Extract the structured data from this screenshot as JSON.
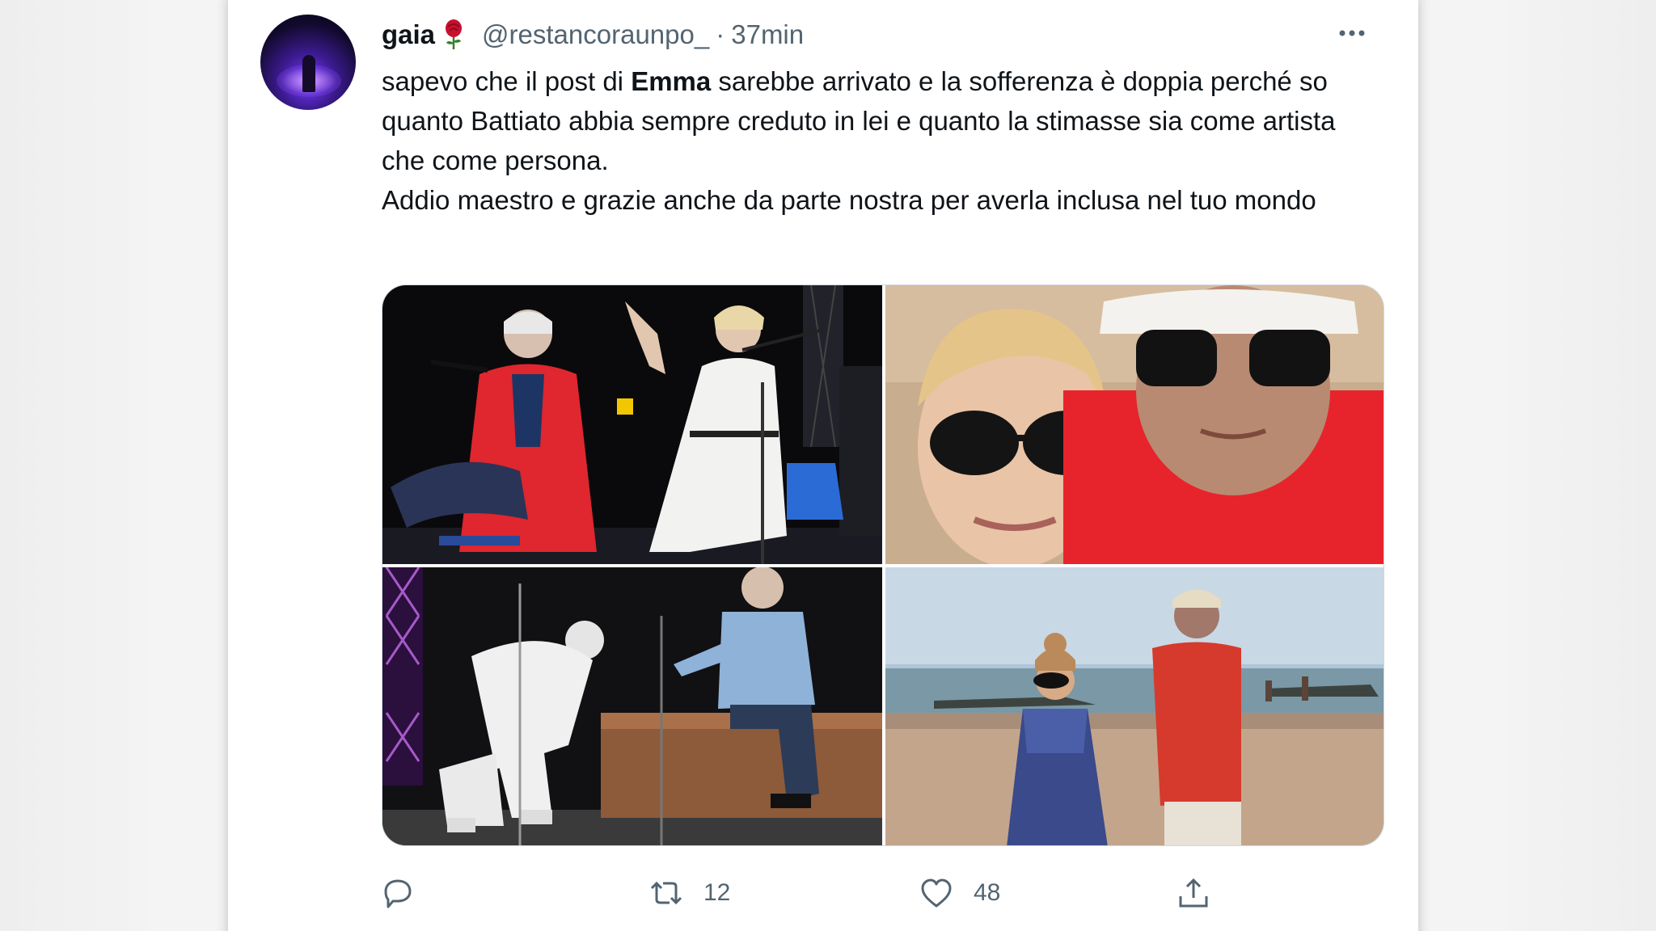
{
  "tweet": {
    "display_name": "gaia",
    "name_emoji": "rose-icon",
    "handle": "@restancoraunpo_",
    "separator": "·",
    "time": "37min",
    "text_line1_before": "sapevo che il post di ",
    "text_line1_bold": "Emma",
    "text_line1_after": " sarebbe arrivato e la sofferenza è doppia perché so quanto Battiato abbia sempre creduto in lei e quanto la stimasse sia come artista che come persona.",
    "text_line2": "Addio maestro e grazie anche da parte nostra per averla inclusa nel tuo mondo",
    "photos": [
      {
        "name": "concert-photo-red-jacket",
        "icon": "photo"
      },
      {
        "name": "selfie-beach-sunglasses",
        "icon": "photo"
      },
      {
        "name": "stage-handshake-photo",
        "icon": "photo"
      },
      {
        "name": "beach-walk-photo",
        "icon": "photo"
      }
    ]
  },
  "actions": {
    "reply_count": "",
    "retweet_count": "12",
    "like_count": "48",
    "share_count": ""
  },
  "colors": {
    "text": "#0f1419",
    "secondary": "#536471",
    "rose": "#c8102e"
  }
}
